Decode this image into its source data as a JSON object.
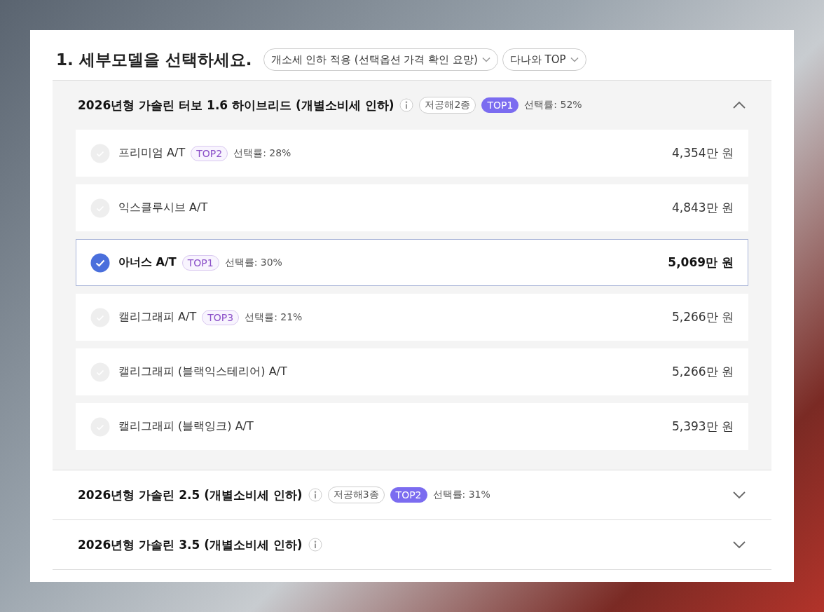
{
  "heading": "1. 세부모델을 선택하세요.",
  "filters": [
    {
      "label": "개소세 인하 적용 (선택옵션 가격 확인 요망)"
    },
    {
      "label": "다나와 TOP"
    }
  ],
  "groups": [
    {
      "title": "2026년형 가솔린 터보 1.6 하이브리드 (개별소비세 인하)",
      "tags": [
        {
          "kind": "outline",
          "text": "저공해2종"
        },
        {
          "kind": "rank",
          "text": "TOP1"
        }
      ],
      "rate": "선택률: 52%",
      "expanded": true,
      "trims": [
        {
          "name": "프리미엄 A/T",
          "rank": "TOP2",
          "rate": "선택률: 28%",
          "price": "4,354만 원",
          "selected": false
        },
        {
          "name": "익스클루시브 A/T",
          "price": "4,843만 원",
          "selected": false
        },
        {
          "name": "아너스 A/T",
          "rank": "TOP1",
          "rate": "선택률: 30%",
          "price": "5,069만 원",
          "selected": true
        },
        {
          "name": "캘리그래피 A/T",
          "rank": "TOP3",
          "rate": "선택률: 21%",
          "price": "5,266만 원",
          "selected": false
        },
        {
          "name": "캘리그래피 (블랙익스테리어) A/T",
          "price": "5,266만 원",
          "selected": false
        },
        {
          "name": "캘리그래피 (블랙잉크) A/T",
          "price": "5,393만 원",
          "selected": false
        }
      ]
    },
    {
      "title": "2026년형 가솔린 2.5 (개별소비세 인하)",
      "tags": [
        {
          "kind": "outline",
          "text": "저공해3종"
        },
        {
          "kind": "rank",
          "text": "TOP2"
        }
      ],
      "rate": "선택률: 31%",
      "expanded": false
    },
    {
      "title": "2026년형 가솔린 3.5 (개별소비세 인하)",
      "expanded": false
    }
  ]
}
